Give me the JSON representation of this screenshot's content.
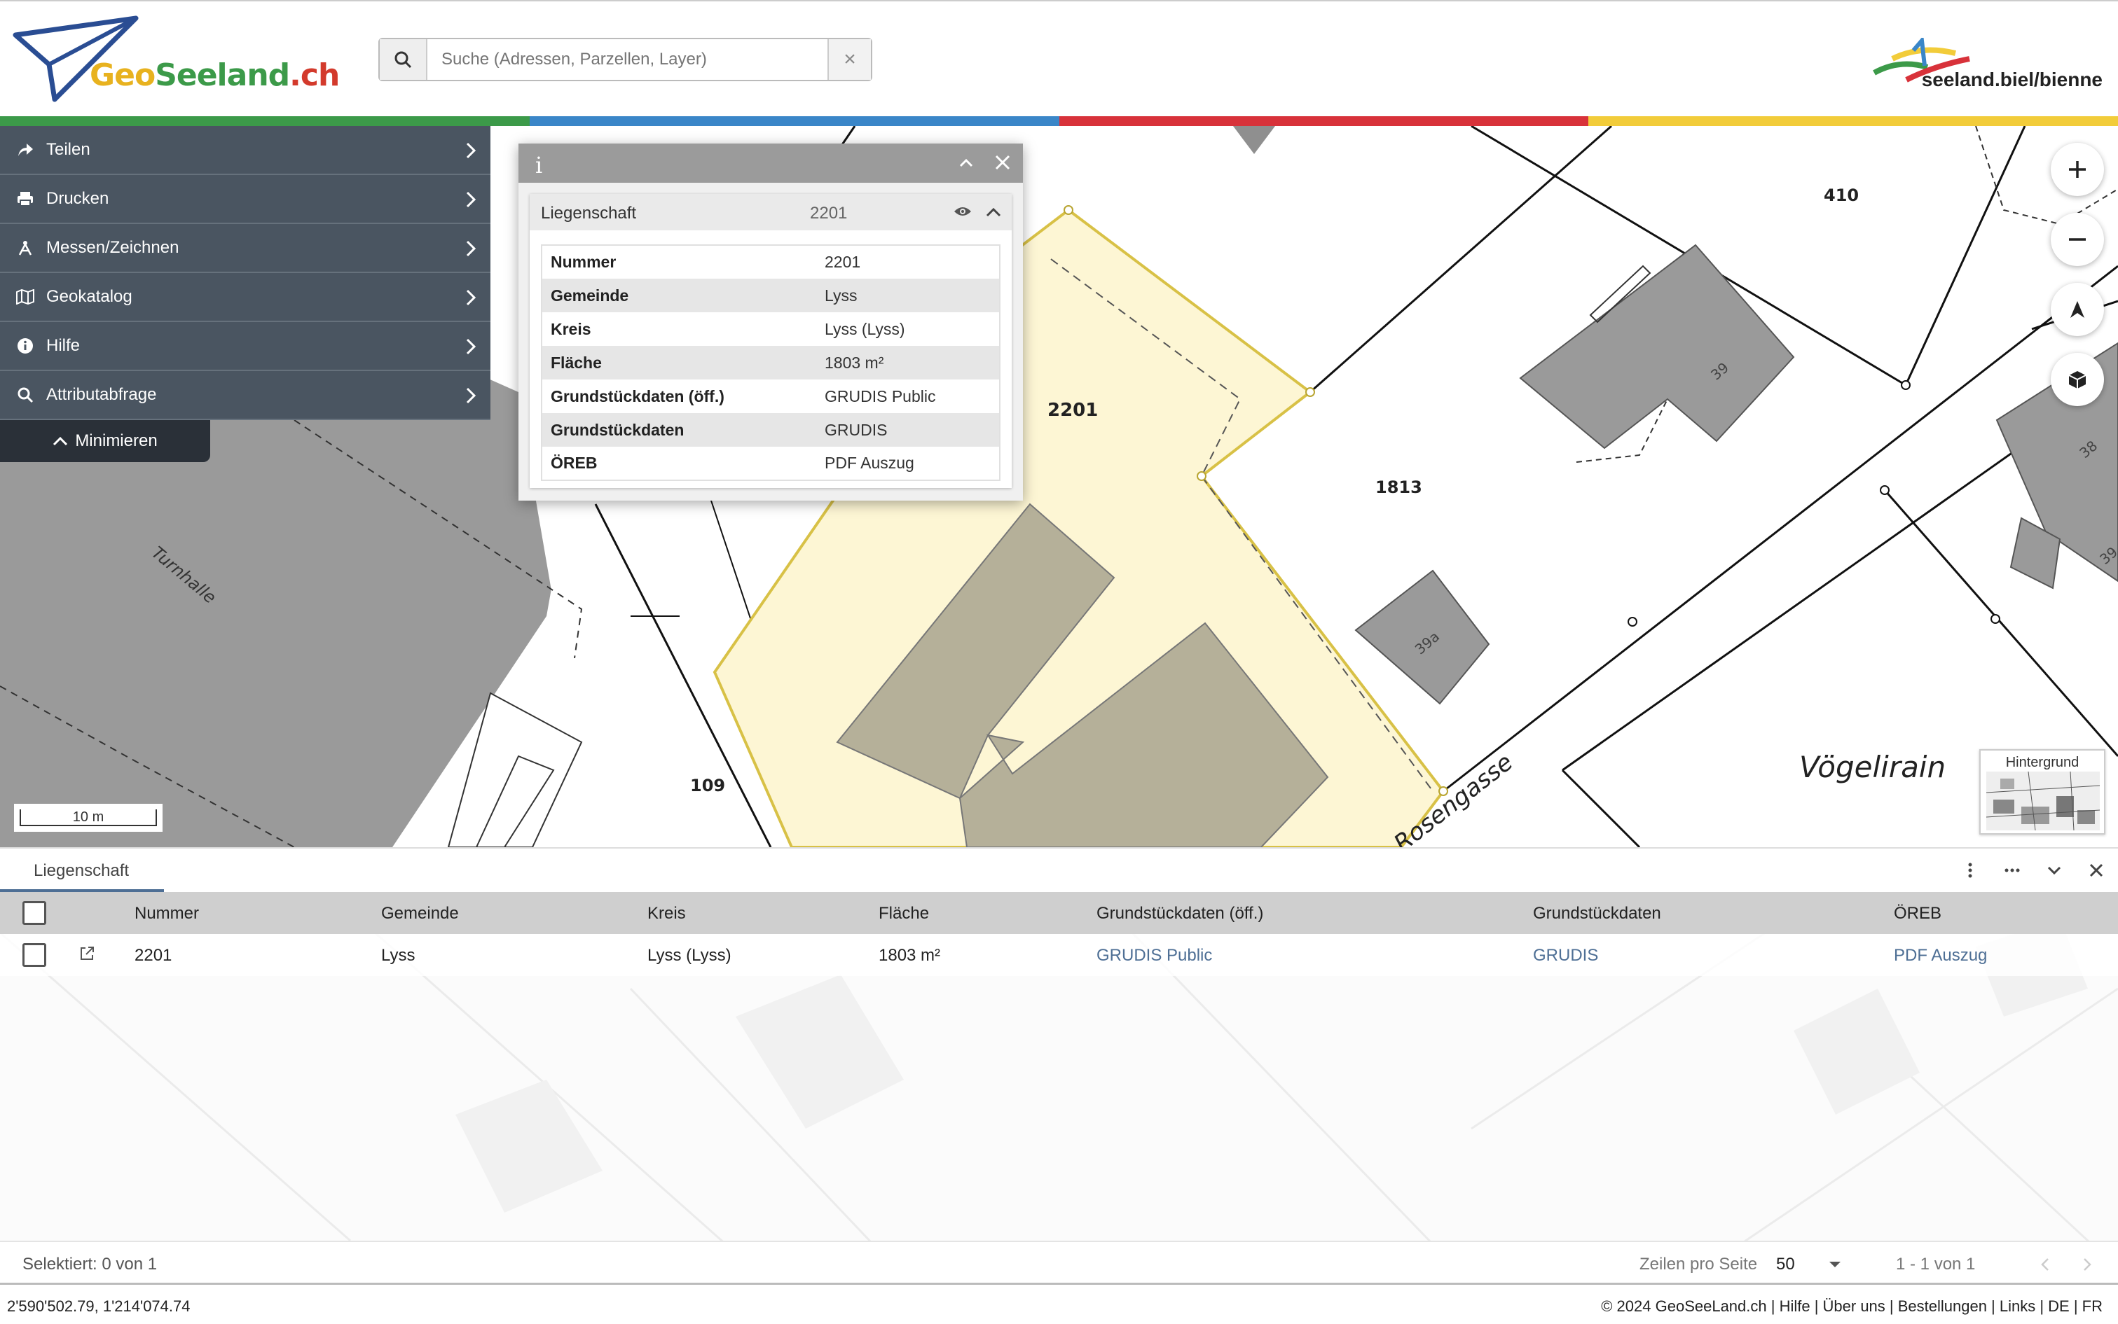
{
  "header": {
    "logo_geo": "Geo",
    "logo_seeland": "Seeland",
    "logo_ch": ".ch",
    "search_placeholder": "Suche (Adressen, Parzellen, Layer)",
    "brand_text": "seeland.biel/bienne"
  },
  "stripe_colors": [
    "#3c9a49",
    "#3a86c8",
    "#d8323a",
    "#f2cc3a"
  ],
  "menu": {
    "items": [
      {
        "label": "Teilen",
        "icon": "share-icon"
      },
      {
        "label": "Drucken",
        "icon": "print-icon"
      },
      {
        "label": "Messen/Zeichnen",
        "icon": "measure-icon"
      },
      {
        "label": "Geokatalog",
        "icon": "map-icon"
      },
      {
        "label": "Hilfe",
        "icon": "info-icon"
      },
      {
        "label": "Attributabfrage",
        "icon": "search-icon"
      }
    ],
    "minimize_label": "Minimieren"
  },
  "popup": {
    "info_glyph": "i",
    "card_title": "Liegenschaft",
    "card_number": "2201",
    "rows": [
      {
        "key": "Nummer",
        "value": "2201"
      },
      {
        "key": "Gemeinde",
        "value": "Lyss"
      },
      {
        "key": "Kreis",
        "value": "Lyss (Lyss)"
      },
      {
        "key": "Fläche",
        "value": "1803 m²"
      },
      {
        "key": "Grundstückdaten (öff.)",
        "value": "GRUDIS Public"
      },
      {
        "key": "Grundstückdaten",
        "value": "GRUDIS"
      },
      {
        "key": "ÖREB",
        "value": "PDF Auszug"
      }
    ]
  },
  "map": {
    "labels": {
      "p2201": "2201",
      "p410": "410",
      "p1813": "1813",
      "p109": "109",
      "h39": "39",
      "h39a": "39a",
      "h38": "38",
      "h39b": "39",
      "turnhalle": "Turnhalle",
      "voegelirain": "Vögelirain",
      "rosengasse": "Rosengasse"
    },
    "scale_label": "10 m",
    "background_label": "Hintergrund"
  },
  "grid": {
    "tab_label": "Liegenschaft",
    "columns": [
      "Nummer",
      "Gemeinde",
      "Kreis",
      "Fläche",
      "Grundstückdaten (öff.)",
      "Grundstückdaten",
      "ÖREB"
    ],
    "row": {
      "nummer": "2201",
      "gemeinde": "Lyss",
      "kreis": "Lyss (Lyss)",
      "flaeche": "1803 m²",
      "grundstueck_oeff": "GRUDIS Public",
      "grundstueck": "GRUDIS",
      "oereb": "PDF Auszug"
    },
    "selected_text": "Selektiert: 0 von 1",
    "rows_per_page_label": "Zeilen pro Seite",
    "rows_per_page_value": "50",
    "range_text": "1 - 1 von 1"
  },
  "status": {
    "coords": "2'590'502.79, 1'214'074.74",
    "footer": "© 2024 GeoSeeLand.ch | Hilfe | Über uns | Bestellungen | Links | DE | FR"
  }
}
